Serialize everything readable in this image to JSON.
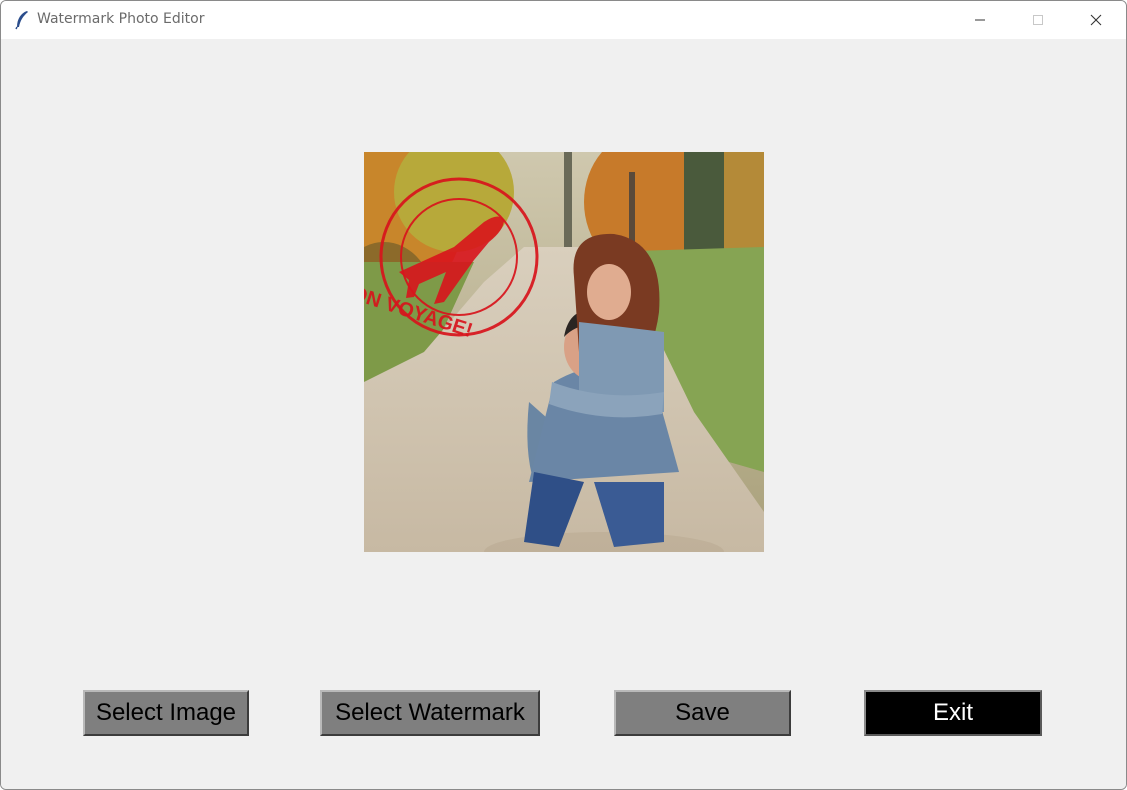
{
  "window": {
    "title": "Watermark Photo Editor",
    "app_icon": "feather-icon",
    "controls": {
      "minimize_icon": "minimize-icon",
      "maximize_icon": "maximize-icon",
      "close_icon": "close-icon"
    }
  },
  "preview": {
    "description_icon": "photo-preview",
    "watermark_text": "BON VOYAGE!",
    "watermark_color": "#d8141c"
  },
  "buttons": {
    "select_image": "Select Image",
    "select_watermark": "Select Watermark",
    "save": "Save",
    "exit": "Exit"
  },
  "colors": {
    "window_bg": "#f0f0f0",
    "button_bg": "#7f7f7f",
    "exit_bg": "#000000",
    "exit_text": "#ffffff"
  }
}
